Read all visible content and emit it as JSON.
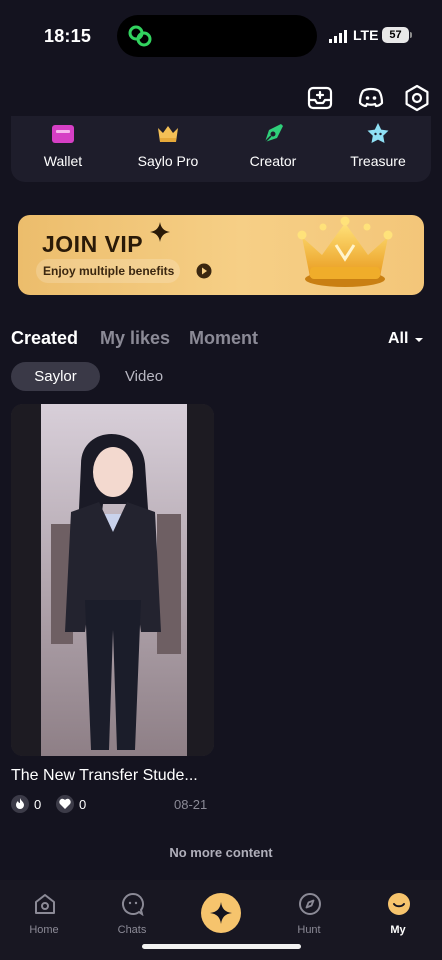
{
  "status_bar": {
    "time": "18:15",
    "network": "LTE",
    "battery": "57"
  },
  "header_icons": [
    "inbox-icon",
    "discord-icon",
    "settings-hex-icon"
  ],
  "quick_menu": [
    {
      "label": "Wallet",
      "icon": "wallet-icon",
      "color": "#d63fc5"
    },
    {
      "label": "Saylo Pro",
      "icon": "crown-icon",
      "color": "#f4c056"
    },
    {
      "label": "Creator",
      "icon": "pen-nib-icon",
      "color": "#2fcf7a"
    },
    {
      "label": "Treasure",
      "icon": "star-treasure-icon",
      "color": "#8fe0f5"
    }
  ],
  "vip_banner": {
    "title": "JOIN VIP",
    "subtitle": "Enjoy multiple benefits"
  },
  "tabs": [
    {
      "label": "Created",
      "active": true
    },
    {
      "label": "My likes",
      "active": false
    },
    {
      "label": "Moment",
      "active": false
    }
  ],
  "filter": {
    "label": "All"
  },
  "subtabs": [
    {
      "label": "Saylor",
      "active": true
    },
    {
      "label": "Video",
      "active": false
    }
  ],
  "cards": [
    {
      "title": "The New Transfer Stude...",
      "likes_fire": "0",
      "likes_heart": "0",
      "date": "08-21"
    }
  ],
  "no_more": "No more content",
  "bottom_nav": [
    {
      "label": "Home",
      "icon": "home-icon",
      "active": false
    },
    {
      "label": "Chats",
      "icon": "chat-icon",
      "active": false
    },
    {
      "label": "",
      "icon": "sparkle-icon",
      "active": false
    },
    {
      "label": "Hunt",
      "icon": "compass-icon",
      "active": false
    },
    {
      "label": "My",
      "icon": "smile-icon",
      "active": true
    }
  ],
  "colors": {
    "background": "#14131f",
    "accent": "#f6c46d",
    "panel": "#1e1d2b"
  }
}
